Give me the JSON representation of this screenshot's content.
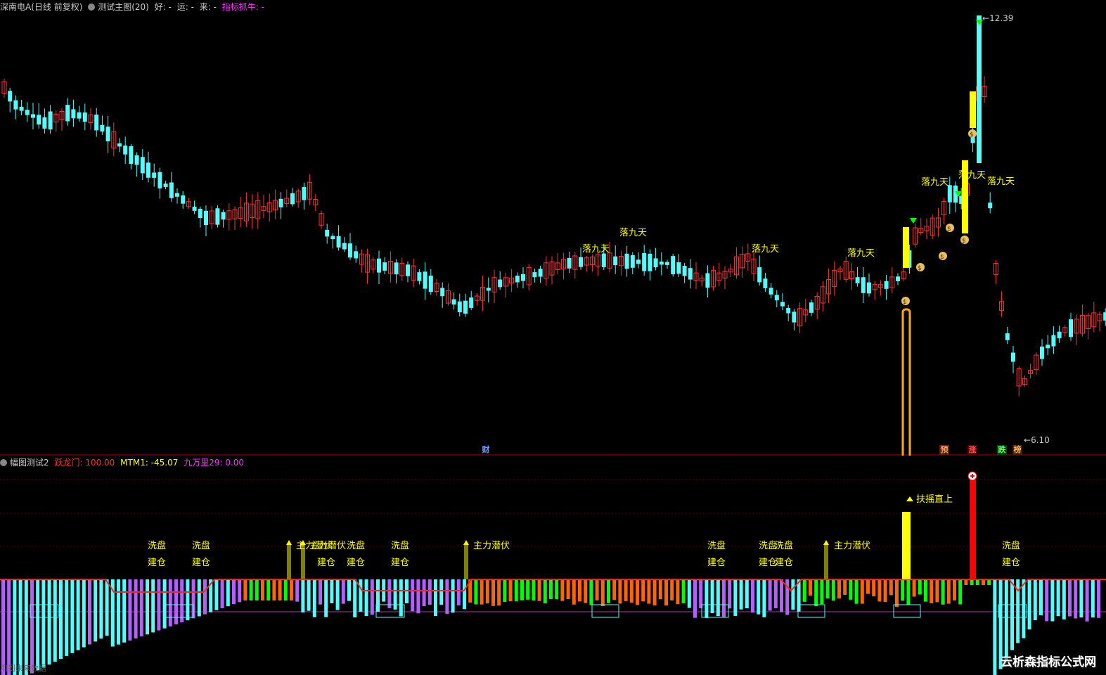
{
  "header": {
    "stock": "深南电A(日线 前复权)",
    "indicator": "测试主图(20)",
    "hao": "好: -",
    "yun": "运: -",
    "lai": "来: -",
    "zhibiao": "指标抓牛: -"
  },
  "sub_header": {
    "name": "幅图测试2",
    "yue": "跃龙门: 100.00",
    "mtm": "MTM1: -45.07",
    "jiu": "九万里29: 0.00"
  },
  "labels": {
    "high": "12.39",
    "low": "6.10",
    "cai": "财",
    "luo": "落九天",
    "xipan": "洗盘",
    "jiancang": "建仓",
    "zhuli": "主力潜伏",
    "fuyao": "扶摇直上",
    "yu": "预",
    "zhang": "涨",
    "die": "跌",
    "bang": "榜",
    "footer": "用到未来数据",
    "watermark": "云析森指标公式网"
  },
  "colors": {
    "up": "#ff3333",
    "down": "#54fcfc",
    "yellow": "#ffff00",
    "magenta": "#ff33ff",
    "olive": "#808000",
    "orange": "#ff6600",
    "green": "#00ff00",
    "purple": "#b45fff",
    "cyan": "#54fcfc"
  }
}
